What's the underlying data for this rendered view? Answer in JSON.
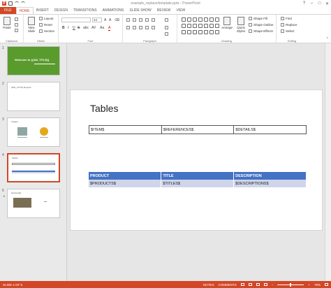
{
  "app": {
    "title": "example_replace/template.pptx - PowerPoint",
    "logo": "P"
  },
  "window": {
    "minimize": "–",
    "maximize": "□",
    "close": "✕",
    "help": "?"
  },
  "tabs": [
    "FILE",
    "HOME",
    "INSERT",
    "DESIGN",
    "TRANSITIONS",
    "ANIMATIONS",
    "SLIDE SHOW",
    "REVIEW",
    "VIEW"
  ],
  "active_tab": "HOME",
  "ribbon": {
    "clipboard": {
      "label": "Clipboard",
      "paste": "Paste"
    },
    "slides": {
      "label": "Slides",
      "new_slide": "New Slide",
      "layout": "Layout",
      "reset": "Reset",
      "section": "Section"
    },
    "font": {
      "label": "Font",
      "size": "44",
      "bold": "B",
      "italic": "I",
      "underline": "U",
      "strike": "S",
      "shadow": "abc",
      "spacing": "AV",
      "case": "Aa",
      "color": "A"
    },
    "paragraph": {
      "label": "Paragraph"
    },
    "drawing": {
      "label": "Drawing",
      "arrange": "Arrange",
      "quick_styles": "Quick Styles",
      "shape_fill": "Shape Fill",
      "shape_outline": "Shape Outline",
      "shape_effects": "Shape Effects"
    },
    "editing": {
      "label": "Editing",
      "find": "Find",
      "replace": "Replace",
      "select": "Select"
    }
  },
  "thumbnails": [
    {
      "num": "1",
      "title": "Welcome to {{AM_TITLE}}",
      "green": true
    },
    {
      "num": "2",
      "title": "{DIR_CTCO} Reports"
    },
    {
      "num": "3",
      "title": "Images"
    },
    {
      "num": "4",
      "title": "Tables"
    },
    {
      "num": "5",
      "title": "Sectionally"
    }
  ],
  "slide": {
    "title": "Tables",
    "table1": [
      "$ITEM$",
      "$REFERENCES$",
      "$DETAILS$"
    ],
    "table2": {
      "headers": [
        "PRODUCT",
        "TITLE",
        "DESCRIPTION"
      ],
      "row": [
        "$PRODUCTS$",
        "$TITLES$",
        "$DESCRIPTIONS$"
      ]
    }
  },
  "status": {
    "slide": "SLIDE 4 OF 5",
    "notes": "NOTES",
    "comments": "COMMENTS",
    "zoom": "78%"
  },
  "colors": {
    "accent": "#d24726",
    "table_header": "#4472c4",
    "table_row": "#cfd5ea",
    "green_slide": "#5a9b2e"
  }
}
